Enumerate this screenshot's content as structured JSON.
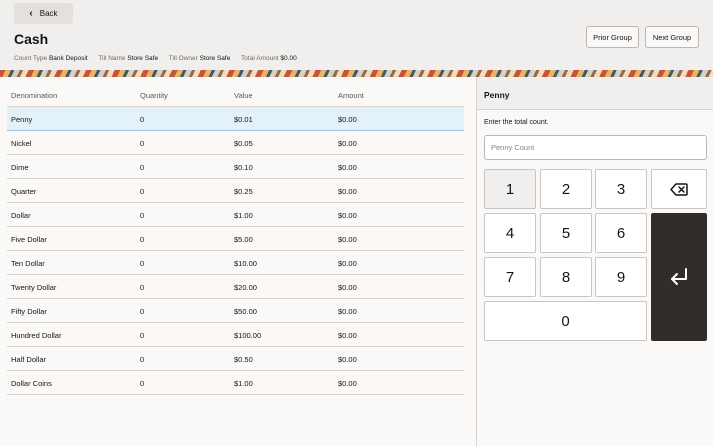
{
  "header": {
    "back_label": "Back",
    "title": "Cash",
    "info": [
      {
        "label": "Count Type",
        "value": "Bank Deposit"
      },
      {
        "label": "Till Name",
        "value": "Store Safe"
      },
      {
        "label": "Till Owner",
        "value": "Store Safe"
      },
      {
        "label": "Total Amount",
        "value": "$0.00"
      }
    ],
    "prior_group_label": "Prior Group",
    "next_group_label": "Next Group"
  },
  "table": {
    "columns": [
      "Denomination",
      "Quantity",
      "Value",
      "Amount"
    ],
    "selected_index": 0,
    "rows": [
      {
        "denomination": "Penny",
        "quantity": "0",
        "value": "$0.01",
        "amount": "$0.00"
      },
      {
        "denomination": "Nickel",
        "quantity": "0",
        "value": "$0.05",
        "amount": "$0.00"
      },
      {
        "denomination": "Dime",
        "quantity": "0",
        "value": "$0.10",
        "amount": "$0.00"
      },
      {
        "denomination": "Quarter",
        "quantity": "0",
        "value": "$0.25",
        "amount": "$0.00"
      },
      {
        "denomination": "Dollar",
        "quantity": "0",
        "value": "$1.00",
        "amount": "$0.00"
      },
      {
        "denomination": "Five Dollar",
        "quantity": "0",
        "value": "$5.00",
        "amount": "$0.00"
      },
      {
        "denomination": "Ten Dollar",
        "quantity": "0",
        "value": "$10.00",
        "amount": "$0.00"
      },
      {
        "denomination": "Twenty Dollar",
        "quantity": "0",
        "value": "$20.00",
        "amount": "$0.00"
      },
      {
        "denomination": "Fifty Dollar",
        "quantity": "0",
        "value": "$50.00",
        "amount": "$0.00"
      },
      {
        "denomination": "Hundred Dollar",
        "quantity": "0",
        "value": "$100.00",
        "amount": "$0.00"
      },
      {
        "denomination": "Half Dollar",
        "quantity": "0",
        "value": "$0.50",
        "amount": "$0.00"
      },
      {
        "denomination": "Dollar Coins",
        "quantity": "0",
        "value": "$1.00",
        "amount": "$0.00"
      }
    ]
  },
  "panel": {
    "title": "Penny",
    "prompt": "Enter the total count.",
    "input_value": "",
    "input_placeholder": "Penny Count"
  },
  "keypad": {
    "keys": [
      "1",
      "2",
      "3",
      "4",
      "5",
      "6",
      "7",
      "8",
      "9",
      "0"
    ],
    "backspace_icon": "backspace-icon",
    "enter_icon": "enter-icon"
  },
  "colors": {
    "selected_row": "#e3f1f8",
    "enter_key": "#312d2a",
    "header_bg": "#f1efed"
  }
}
